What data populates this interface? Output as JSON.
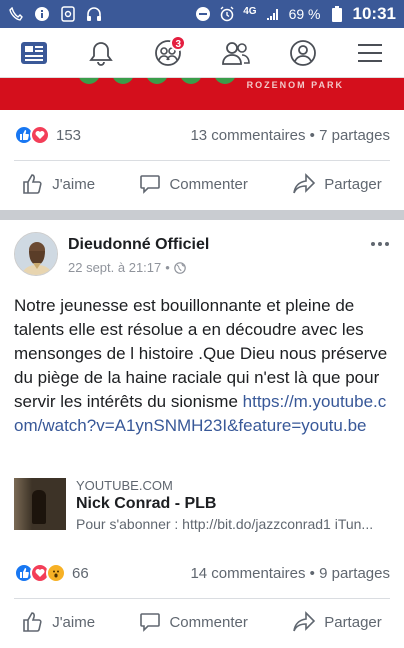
{
  "status_bar": {
    "network": "4G",
    "battery": "69 %",
    "time": "10:31"
  },
  "nav": {
    "friends_badge": "3"
  },
  "banner": {
    "partial_text": "ROZENOM PARK"
  },
  "post1": {
    "reaction_count": "153",
    "comments": "13 commentaires",
    "shares": "7 partages",
    "separator": "•"
  },
  "actions": {
    "like": "J'aime",
    "comment": "Commenter",
    "share": "Partager"
  },
  "post2": {
    "author": "Dieudonné Officiel",
    "date": "22 sept. à 21:17",
    "date_sep": "•",
    "text": "Notre jeunesse est bouillonnante et pleine de talents elle est résolue a en  découdre avec les mensonges de l histoire .Que Dieu nous préserve du piège de la haine raciale qui n'est là que pour servir les intérêts du sionisme ",
    "link": "https://m.youtube.com/watch?v=A1ynSNMH23I&feature=youtu.be",
    "preview": {
      "domain": "YOUTUBE.COM",
      "title": "Nick Conrad - PLB",
      "description": "Pour s'abonner : http://bit.do/jazzconrad1 iTun..."
    },
    "reaction_count": "66",
    "comments": "14 commentaires",
    "shares": "9 partages",
    "separator": "•"
  },
  "colors": {
    "brand": "#3b5998",
    "banner": "#d40f1c",
    "link": "#385898",
    "badge": "#e41e3f"
  }
}
